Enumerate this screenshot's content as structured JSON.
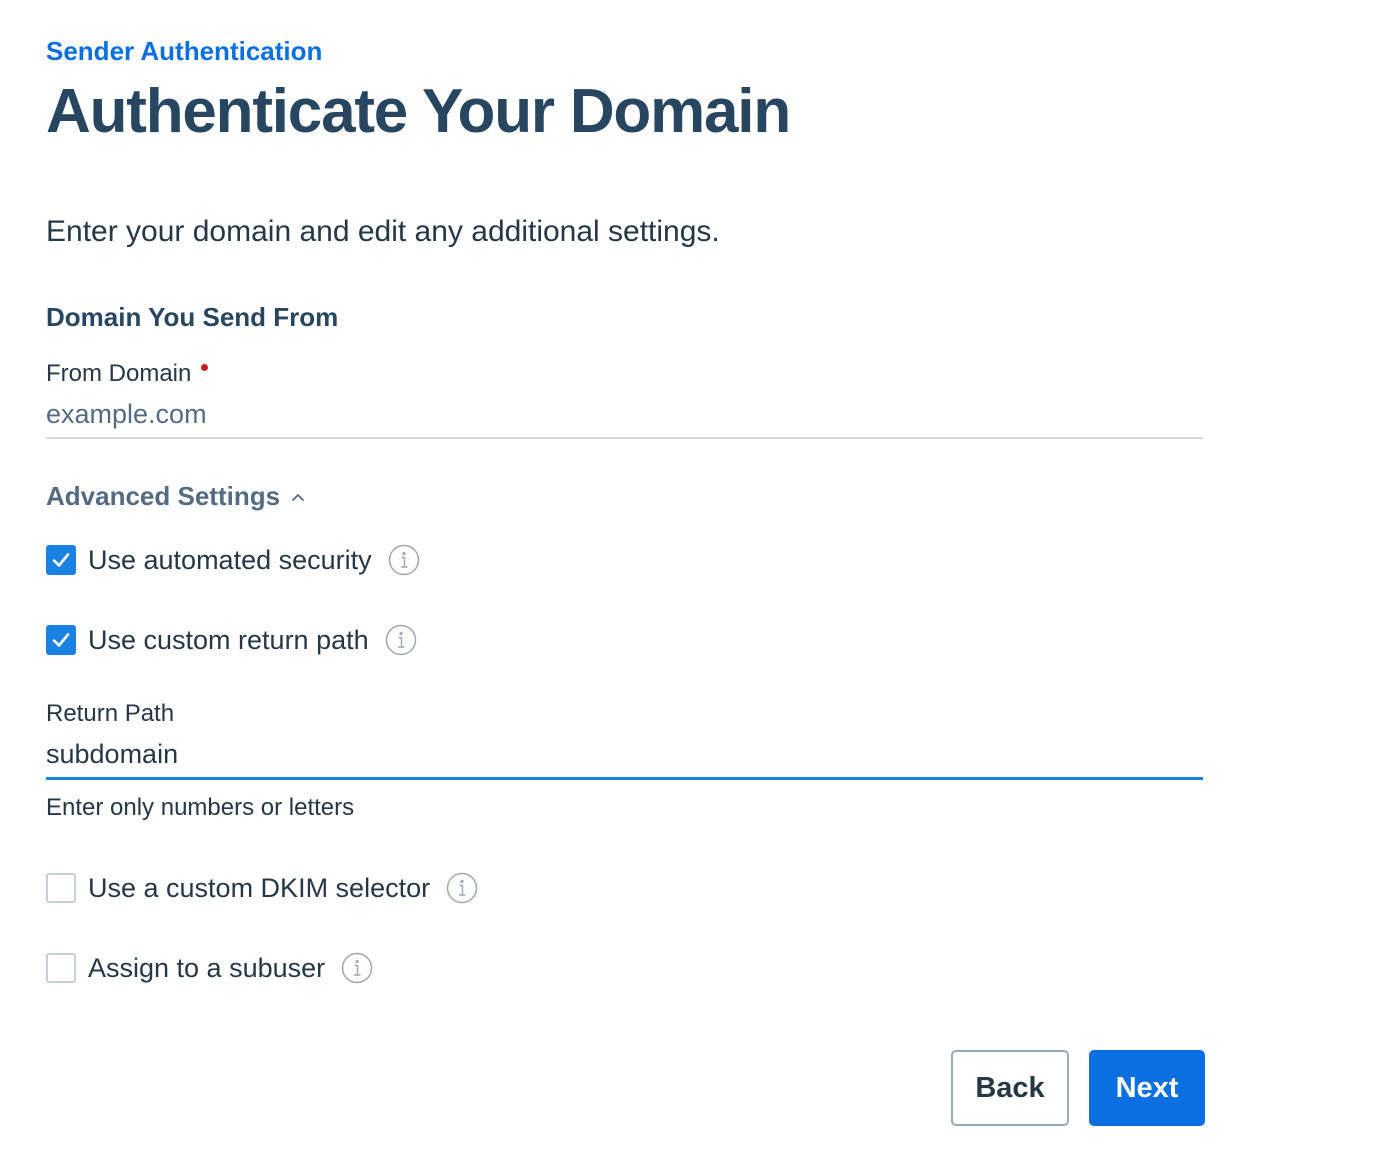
{
  "breadcrumb": "Sender Authentication",
  "title": "Authenticate Your Domain",
  "intro": "Enter your domain and edit any additional settings.",
  "domain_section": {
    "heading": "Domain You Send From",
    "from_domain_label": "From Domain",
    "from_domain_value": "example.com"
  },
  "advanced": {
    "label": "Advanced Settings",
    "options": [
      {
        "label": "Use automated security",
        "checked": true
      },
      {
        "label": "Use custom return path",
        "checked": true
      },
      {
        "label": "Use a custom DKIM selector",
        "checked": false
      },
      {
        "label": "Assign to a subuser",
        "checked": false
      }
    ],
    "return_path": {
      "label": "Return Path",
      "value": "subdomain",
      "helper": "Enter only numbers or letters"
    }
  },
  "buttons": {
    "back": "Back",
    "next": "Next"
  },
  "colors": {
    "accent": "#1a82e2",
    "primary_button": "#0a6fe0",
    "required": "#c32222",
    "heading": "#294661"
  },
  "icons": [
    "chevron-up-icon",
    "checkmark-icon",
    "info-icon"
  ]
}
